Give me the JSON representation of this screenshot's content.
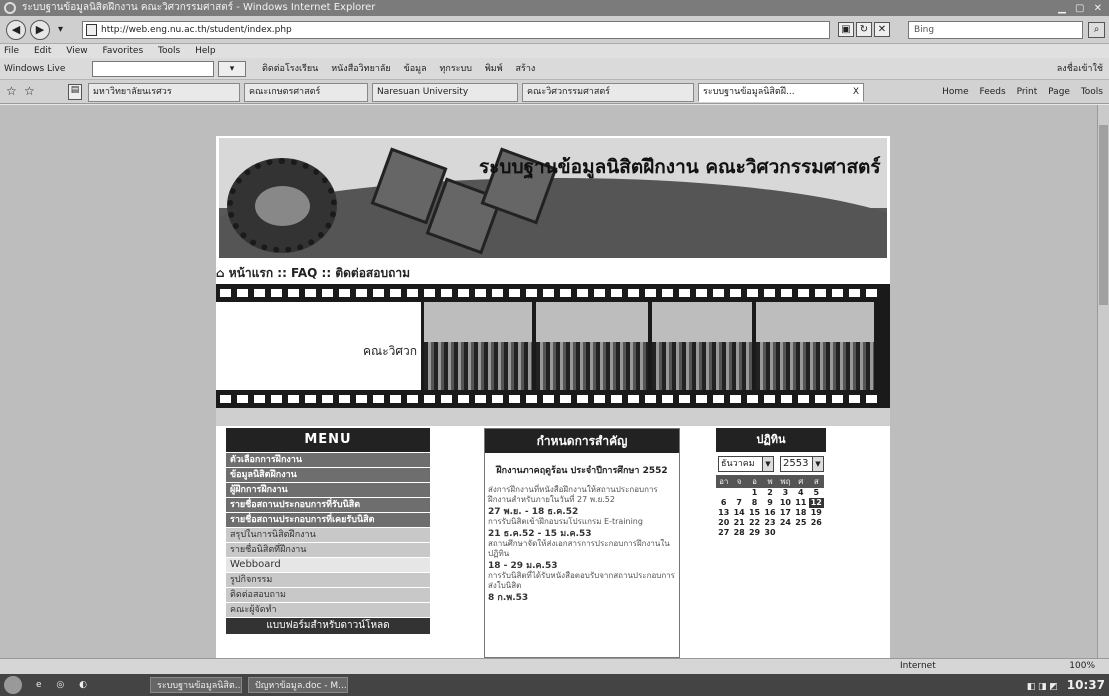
{
  "window": {
    "title": "ระบบฐานข้อมูลนิสิตฝึกงาน คณะวิศวกรรมศาสตร์ - Windows Internet Explorer"
  },
  "address_bar": {
    "back_glyph": "◀",
    "forward_glyph": "▶",
    "dropdown_glyph": "▾",
    "url": "http://web.eng.nu.ac.th/student/index.php",
    "search_placeholder": "Bing",
    "refresh_glyph": "↻",
    "stop_glyph": "✕",
    "search_glyph": "⌕"
  },
  "menu_bar": [
    "File",
    "Edit",
    "View",
    "Favorites",
    "Tools",
    "Help"
  ],
  "links_bar": {
    "windows_live": "Windows Live",
    "go_label": "▾",
    "links": [
      "ติดต่อโรงเรียน",
      "หนังสือวิทยาลัย",
      "ข้อมูล",
      "ทุกระบบ",
      "พิมพ์",
      "สร้าง"
    ],
    "right_label": "ลงชื่อเข้าใช้"
  },
  "tabs": {
    "favorites_glyph": "☆",
    "add_favorite_glyph": "☆",
    "quick_tabs_glyph": "▤",
    "items": [
      {
        "label": "มหาวิทยาลัยนเรศวร"
      },
      {
        "label": "คณะเกษตรศาสตร์"
      },
      {
        "label": "Naresuan University"
      },
      {
        "label": "คณะวิศวกรรมศาสตร์"
      },
      {
        "label": "ระบบฐานข้อมูลนิสิตฝึ...",
        "active": true
      }
    ],
    "close_glyph": "X",
    "tools": [
      "Home",
      "Feeds",
      "Print",
      "Page",
      "Tools"
    ]
  },
  "site": {
    "banner_title": "ระบบฐานข้อมูลนิสิตฝึกงาน คณะวิศวกรรมศาสตร์",
    "crumbs": [
      "หน้าแรก",
      "FAQ",
      "ติดต่อสอบถาม"
    ],
    "crumb_home_glyph": "⌂",
    "faculty_label": "คณะวิศวก",
    "menu": {
      "title": "MENU",
      "items": [
        {
          "label": "ตัวเลือกการฝึกงาน",
          "style": "dark"
        },
        {
          "label": "ข้อมูลนิสิตฝึกงาน",
          "style": "dark"
        },
        {
          "label": "ผู้ฝึกการฝึกงาน",
          "style": "dark"
        },
        {
          "label": "รายชื่อสถานประกอบการที่รับนิสิต",
          "style": "dark"
        },
        {
          "label": "รายชื่อสถานประกอบการที่เคยรับนิสิต",
          "style": "dark"
        },
        {
          "label": "สรุปในการนิสิตฝึกงาน",
          "style": "light"
        },
        {
          "label": "รายชื่อนิสิตที่ฝึกงาน",
          "style": "light"
        },
        {
          "label": "Webboard",
          "style": "web"
        },
        {
          "label": "รูปกิจกรรม",
          "style": "light"
        },
        {
          "label": "ติดต่อสอบถาม",
          "style": "light"
        },
        {
          "label": "คณะผู้จัดทำ",
          "style": "light"
        }
      ],
      "footer": "แบบฟอร์มสำหรับดาวน์โหลด"
    },
    "events": {
      "title": "กำหนดการสำคัญ",
      "subtitle": "ฝึกงานภาคฤดูร้อน ประจำปีการศึกษา 2552",
      "items": [
        {
          "date": "",
          "text": "ส่งการฝึกงานที่หนังสือฝึกงานให้สถานประกอบการฝึกงานสำหรับภายในวันที่ 27 พ.ย.52"
        },
        {
          "date": "27 พ.ย. - 18 ธ.ค.52",
          "text": "การรับนิสิตเข้าฝึกอบรมโปรแกรม E-training"
        },
        {
          "date": "21 ธ.ค.52 - 15 ม.ค.53",
          "text": "สถานศึกษาจัดให้ส่งเอกสารการประกอบการฝึกงานในปฏิทิน"
        },
        {
          "date": "18 - 29 ม.ค.53",
          "text": "การรับนิสิตที่ได้รับหนังสือตอบรับจากสถานประกอบการส่งใบนิสิต"
        },
        {
          "date": "8 ก.พ.53",
          "text": ""
        }
      ]
    },
    "calendar": {
      "title": "ปฏิทิน",
      "month": "ธันวาคม",
      "year": "2553",
      "arrow_glyph": "▼",
      "weekdays": [
        "อา",
        "จ",
        "อ",
        "พ",
        "พฤ",
        "ศ",
        "ส"
      ],
      "weeks": [
        [
          "",
          "",
          "1",
          "2",
          "3",
          "4",
          "5"
        ],
        [
          "6",
          "7",
          "8",
          "9",
          "10",
          "11",
          "12"
        ],
        [
          "13",
          "14",
          "15",
          "16",
          "17",
          "18",
          "19"
        ],
        [
          "20",
          "21",
          "22",
          "23",
          "24",
          "25",
          "26"
        ],
        [
          "27",
          "28",
          "29",
          "30",
          "",
          "",
          ""
        ]
      ],
      "today": "12"
    }
  },
  "status_bar": {
    "zone": "Internet",
    "zoom": "100%"
  },
  "taskbar": {
    "quick_launch": "e ◎ ◐",
    "buttons": [
      "ระบบฐานข้อมูลนิสิต...",
      "ปัญหาข้อมูล.doc - M..."
    ],
    "tray": "◧ ◨ ◩",
    "clock": "10:37"
  }
}
